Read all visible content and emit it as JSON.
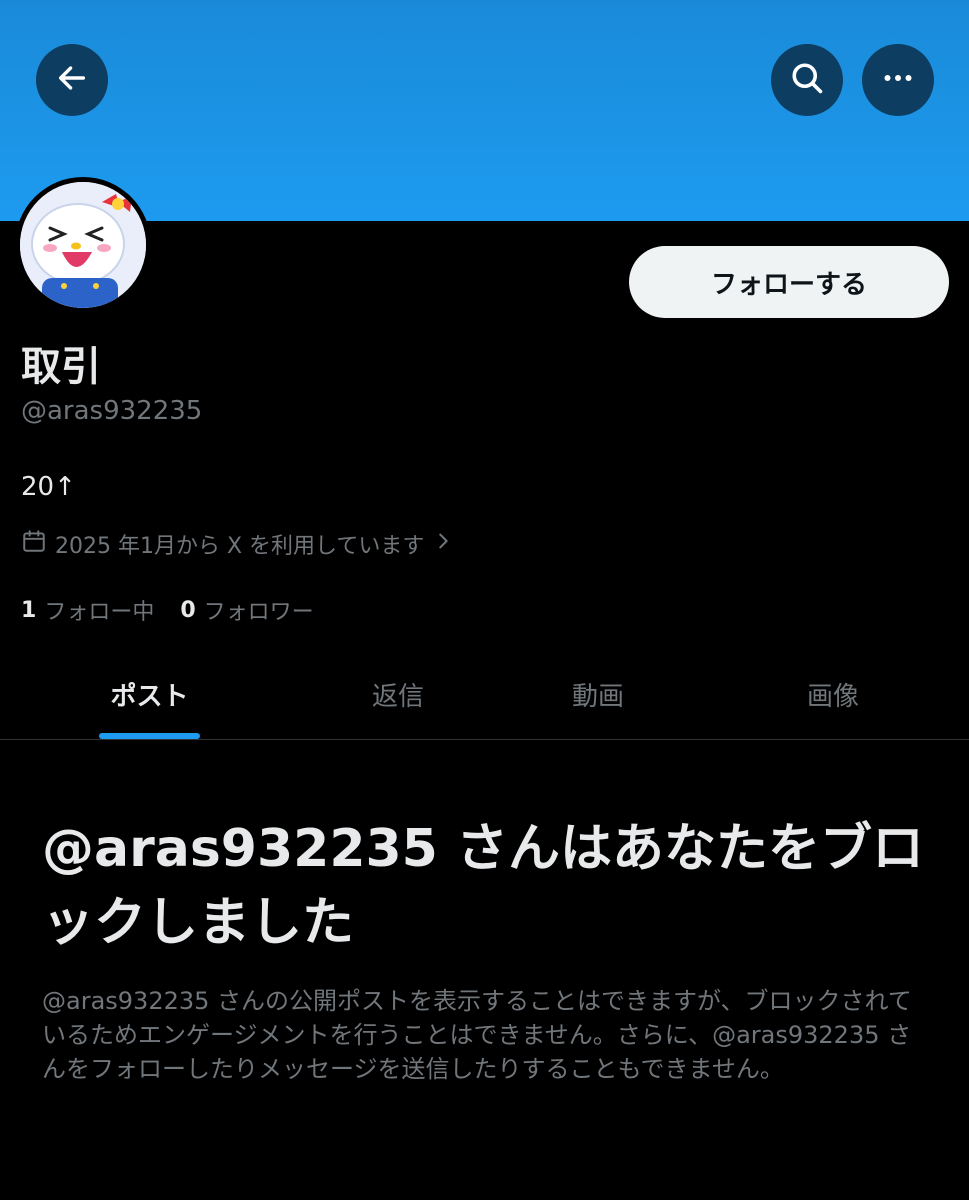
{
  "header": {
    "back_icon": "arrow-left-icon",
    "search_icon": "search-icon",
    "more_icon": "more-horizontal-icon",
    "banner_color": "#1d9bf0"
  },
  "profile": {
    "display_name": "取引",
    "handle": "@aras932235",
    "bio": "20↑",
    "joined": "2025 年1月から X を利用しています",
    "follow_button": "フォローする",
    "following_count": "1",
    "following_label": "フォロー中",
    "followers_count": "0",
    "followers_label": "フォロワー"
  },
  "tabs": [
    {
      "label": "ポスト",
      "active": true
    },
    {
      "label": "返信",
      "active": false
    },
    {
      "label": "動画",
      "active": false
    },
    {
      "label": "画像",
      "active": false
    }
  ],
  "blocked": {
    "title": "@aras932235 さんはあなたをブロックしました",
    "message": "@aras932235 さんの公開ポストを表示することはできますが、ブロックされているためエンゲージメントを行うことはできません。さらに、@aras932235 さんをフォローしたりメッセージを送信したりすることもできません。"
  },
  "colors": {
    "accent": "#1d9bf0",
    "background": "#000000",
    "text_primary": "#e7e9ea",
    "text_secondary": "#71767b"
  }
}
